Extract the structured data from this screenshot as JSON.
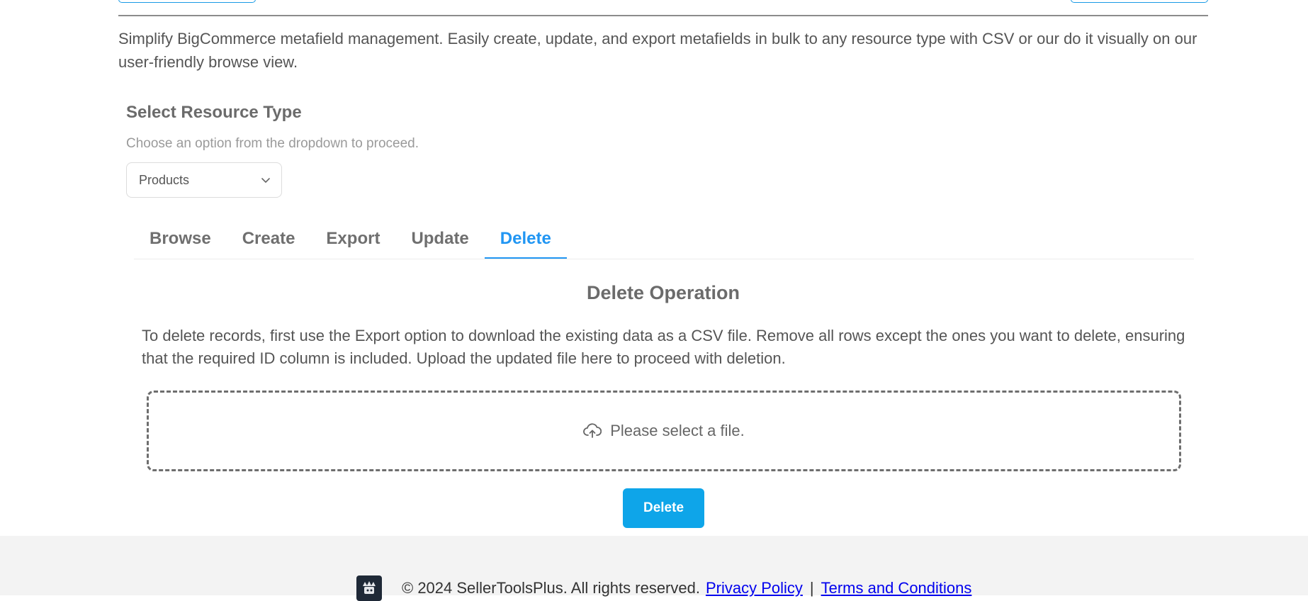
{
  "intro": "Simplify BigCommerce metafield management. Easily create, update, and export metafields in bulk to any resource type with CSV or our do it visually on our user-friendly browse view.",
  "resource": {
    "title": "Select Resource Type",
    "hint": "Choose an option from the dropdown to proceed.",
    "selected": "Products"
  },
  "tabs": [
    {
      "label": "Browse",
      "active": false
    },
    {
      "label": "Create",
      "active": false
    },
    {
      "label": "Export",
      "active": false
    },
    {
      "label": "Update",
      "active": false
    },
    {
      "label": "Delete",
      "active": true
    }
  ],
  "operation": {
    "title": "Delete Operation",
    "description": "To delete records, first use the Export option to download the existing data as a CSV file. Remove all rows except the ones you want to delete, ensuring that the required ID column is included. Upload the updated file here to proceed with deletion.",
    "dropzone_text": "Please select a file.",
    "button_label": "Delete"
  },
  "footer": {
    "copyright": "© 2024 SellerToolsPlus. All rights reserved.",
    "privacy_link": "Privacy Policy",
    "separator": "|",
    "terms_link": "Terms and Conditions"
  },
  "colors": {
    "accent": "#2196f3",
    "button": "#0ea5e9",
    "link": "#1a7f8e",
    "footer_bg": "#f3f3f3"
  },
  "icons": {
    "dropdown": "chevron-down-icon",
    "upload": "cloud-upload-icon",
    "logo": "brand-logo"
  }
}
